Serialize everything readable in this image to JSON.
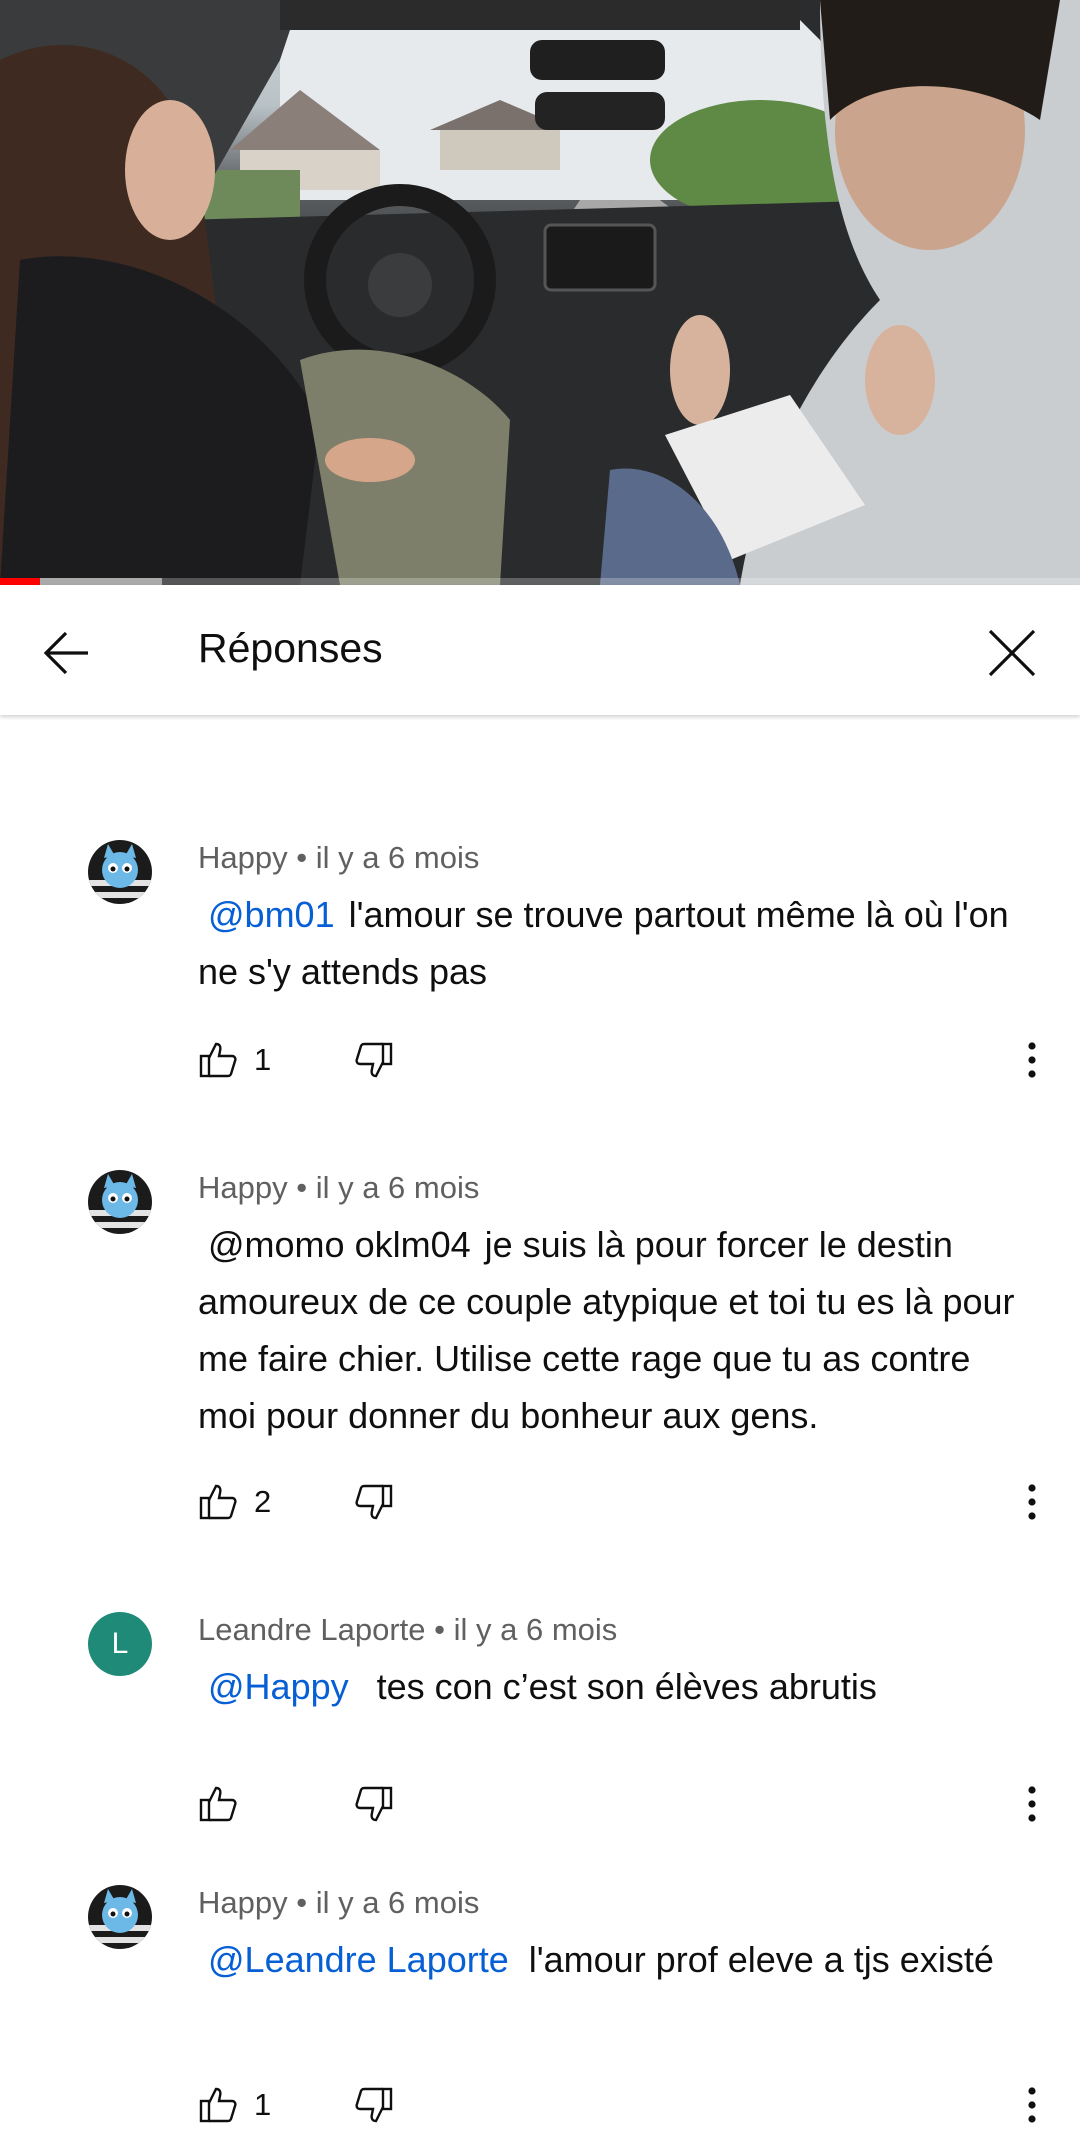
{
  "header": {
    "title": "Réponses",
    "back_icon": "arrow-left-icon",
    "close_icon": "close-icon"
  },
  "comments": [
    {
      "author": "Happy",
      "time": "il y a 6 mois",
      "mention": "@bm01",
      "text": "l'amour se trouve partout même là où l'on ne s'y attends pas",
      "likes": "1",
      "avatar": "blue-cat-avatar"
    },
    {
      "author": "Happy",
      "time": "il y a 6 mois",
      "mention": "@momo oklm04",
      "text": "je suis là pour forcer le destin amoureux de ce couple atypique et toi tu es là pour me faire chier. Utilise cette rage que tu as contre moi pour donner du bonheur aux gens.",
      "likes": "2",
      "avatar": "blue-cat-avatar"
    },
    {
      "author": "Leandre Laporte",
      "time": "il y a 6 mois",
      "mention": "@Happy",
      "text": "tes con c’est son élèves abrutis",
      "likes": "",
      "avatar_letter": "L"
    },
    {
      "author": "Happy",
      "time": "il y a 6 mois",
      "mention": "@Leandre Laporte",
      "text": "l'amour prof eleve a tjs existé",
      "likes": "1",
      "avatar": "blue-cat-avatar"
    }
  ],
  "colors": {
    "mention": "#065fd4",
    "meta": "#606060",
    "progress": "#ff0000",
    "avatar_letter_bg": "#1f8a78"
  }
}
